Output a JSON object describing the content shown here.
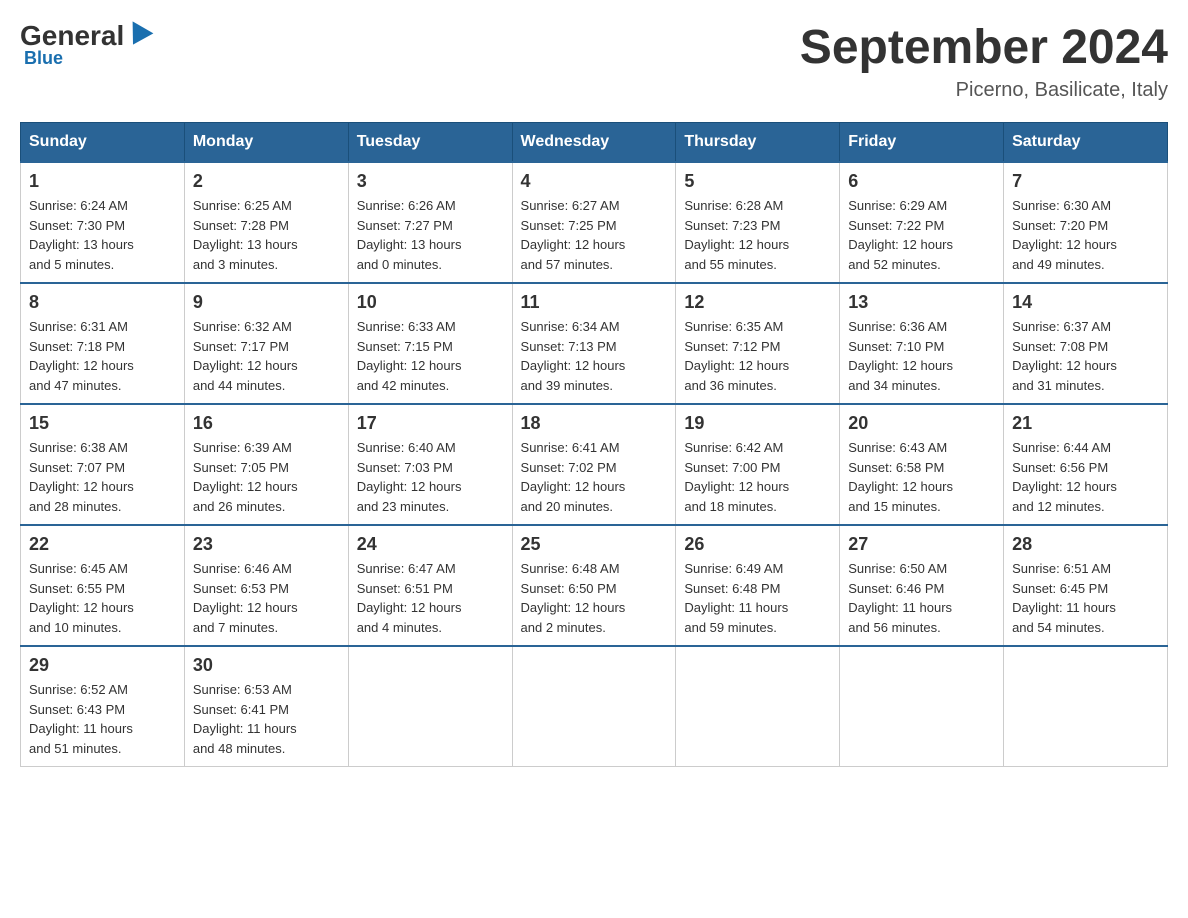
{
  "logo": {
    "general": "General",
    "blue": "Blue"
  },
  "title": "September 2024",
  "location": "Picerno, Basilicate, Italy",
  "days_header": [
    "Sunday",
    "Monday",
    "Tuesday",
    "Wednesday",
    "Thursday",
    "Friday",
    "Saturday"
  ],
  "weeks": [
    [
      {
        "day": "1",
        "sunrise": "6:24 AM",
        "sunset": "7:30 PM",
        "daylight": "13 hours and 5 minutes."
      },
      {
        "day": "2",
        "sunrise": "6:25 AM",
        "sunset": "7:28 PM",
        "daylight": "13 hours and 3 minutes."
      },
      {
        "day": "3",
        "sunrise": "6:26 AM",
        "sunset": "7:27 PM",
        "daylight": "13 hours and 0 minutes."
      },
      {
        "day": "4",
        "sunrise": "6:27 AM",
        "sunset": "7:25 PM",
        "daylight": "12 hours and 57 minutes."
      },
      {
        "day": "5",
        "sunrise": "6:28 AM",
        "sunset": "7:23 PM",
        "daylight": "12 hours and 55 minutes."
      },
      {
        "day": "6",
        "sunrise": "6:29 AM",
        "sunset": "7:22 PM",
        "daylight": "12 hours and 52 minutes."
      },
      {
        "day": "7",
        "sunrise": "6:30 AM",
        "sunset": "7:20 PM",
        "daylight": "12 hours and 49 minutes."
      }
    ],
    [
      {
        "day": "8",
        "sunrise": "6:31 AM",
        "sunset": "7:18 PM",
        "daylight": "12 hours and 47 minutes."
      },
      {
        "day": "9",
        "sunrise": "6:32 AM",
        "sunset": "7:17 PM",
        "daylight": "12 hours and 44 minutes."
      },
      {
        "day": "10",
        "sunrise": "6:33 AM",
        "sunset": "7:15 PM",
        "daylight": "12 hours and 42 minutes."
      },
      {
        "day": "11",
        "sunrise": "6:34 AM",
        "sunset": "7:13 PM",
        "daylight": "12 hours and 39 minutes."
      },
      {
        "day": "12",
        "sunrise": "6:35 AM",
        "sunset": "7:12 PM",
        "daylight": "12 hours and 36 minutes."
      },
      {
        "day": "13",
        "sunrise": "6:36 AM",
        "sunset": "7:10 PM",
        "daylight": "12 hours and 34 minutes."
      },
      {
        "day": "14",
        "sunrise": "6:37 AM",
        "sunset": "7:08 PM",
        "daylight": "12 hours and 31 minutes."
      }
    ],
    [
      {
        "day": "15",
        "sunrise": "6:38 AM",
        "sunset": "7:07 PM",
        "daylight": "12 hours and 28 minutes."
      },
      {
        "day": "16",
        "sunrise": "6:39 AM",
        "sunset": "7:05 PM",
        "daylight": "12 hours and 26 minutes."
      },
      {
        "day": "17",
        "sunrise": "6:40 AM",
        "sunset": "7:03 PM",
        "daylight": "12 hours and 23 minutes."
      },
      {
        "day": "18",
        "sunrise": "6:41 AM",
        "sunset": "7:02 PM",
        "daylight": "12 hours and 20 minutes."
      },
      {
        "day": "19",
        "sunrise": "6:42 AM",
        "sunset": "7:00 PM",
        "daylight": "12 hours and 18 minutes."
      },
      {
        "day": "20",
        "sunrise": "6:43 AM",
        "sunset": "6:58 PM",
        "daylight": "12 hours and 15 minutes."
      },
      {
        "day": "21",
        "sunrise": "6:44 AM",
        "sunset": "6:56 PM",
        "daylight": "12 hours and 12 minutes."
      }
    ],
    [
      {
        "day": "22",
        "sunrise": "6:45 AM",
        "sunset": "6:55 PM",
        "daylight": "12 hours and 10 minutes."
      },
      {
        "day": "23",
        "sunrise": "6:46 AM",
        "sunset": "6:53 PM",
        "daylight": "12 hours and 7 minutes."
      },
      {
        "day": "24",
        "sunrise": "6:47 AM",
        "sunset": "6:51 PM",
        "daylight": "12 hours and 4 minutes."
      },
      {
        "day": "25",
        "sunrise": "6:48 AM",
        "sunset": "6:50 PM",
        "daylight": "12 hours and 2 minutes."
      },
      {
        "day": "26",
        "sunrise": "6:49 AM",
        "sunset": "6:48 PM",
        "daylight": "11 hours and 59 minutes."
      },
      {
        "day": "27",
        "sunrise": "6:50 AM",
        "sunset": "6:46 PM",
        "daylight": "11 hours and 56 minutes."
      },
      {
        "day": "28",
        "sunrise": "6:51 AM",
        "sunset": "6:45 PM",
        "daylight": "11 hours and 54 minutes."
      }
    ],
    [
      {
        "day": "29",
        "sunrise": "6:52 AM",
        "sunset": "6:43 PM",
        "daylight": "11 hours and 51 minutes."
      },
      {
        "day": "30",
        "sunrise": "6:53 AM",
        "sunset": "6:41 PM",
        "daylight": "11 hours and 48 minutes."
      },
      null,
      null,
      null,
      null,
      null
    ]
  ],
  "labels": {
    "sunrise": "Sunrise:",
    "sunset": "Sunset:",
    "daylight": "Daylight:"
  }
}
